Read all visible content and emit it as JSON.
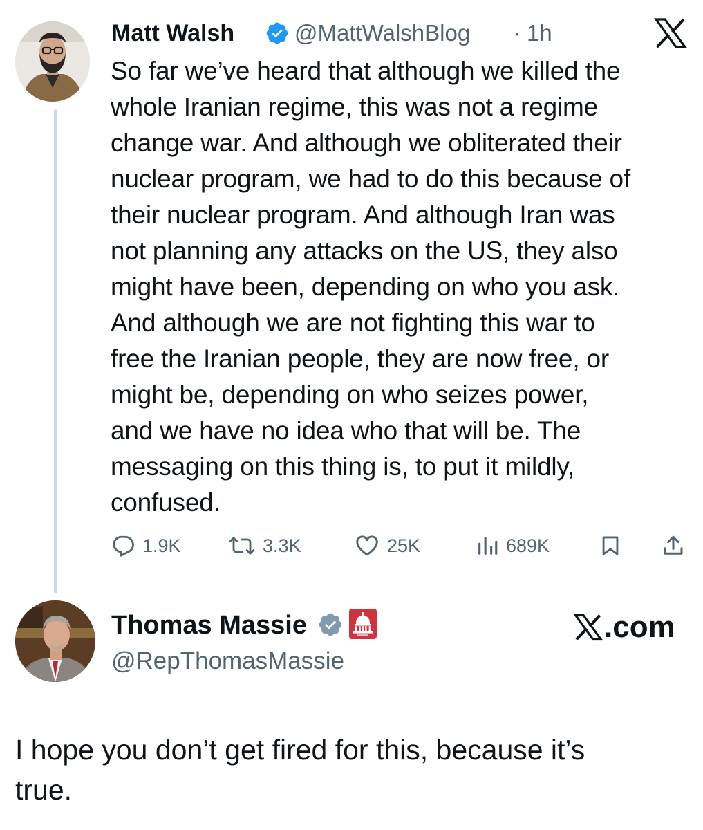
{
  "post": {
    "author_name": "Matt Walsh",
    "handle": "@MattWalshBlog",
    "separator": "·",
    "time": "1h",
    "text_lines": [
      "So far we’ve heard that although we killed the",
      "whole Iranian regime, this was not a regime",
      "change war. And although we obliterated their",
      "nuclear program, we had to do this because of",
      "their nuclear program. And although Iran was",
      "not planning any attacks on the US, they also",
      "might have been, depending on who you ask.",
      "And although we are not fighting this war to",
      "free the Iranian people, they are now free, or",
      "might be, depending on who seizes power,",
      "and we have no idea who that will be. The",
      "messaging on this thing is, to put it mildly,",
      "confused."
    ],
    "stats": {
      "replies": "1.9K",
      "reposts": "3.3K",
      "likes": "25K",
      "views": "689K"
    },
    "icons": {
      "verified": "verified-badge-icon",
      "platform": "x-logo-icon",
      "reply": "reply-icon",
      "repost": "repost-icon",
      "like": "heart-icon",
      "views": "views-chart-icon",
      "bookmark": "bookmark-icon",
      "share": "share-icon"
    }
  },
  "reply": {
    "author_name": "Thomas Massie",
    "handle": "@RepThomasMassie",
    "site": ".com",
    "text_lines": [
      "I hope you don’t get fired for this, because it’s",
      "true."
    ],
    "icons": {
      "verified": "gray-verified-badge-icon",
      "affiliation": "capitol-government-badge-icon",
      "platform": "x-logo-icon"
    }
  },
  "colors": {
    "verified_blue": "#1d9bf0",
    "gov_red": "#d0323e",
    "secondary_text": "#536471",
    "primary_text": "#0f1419",
    "thread_line": "#cfd9de"
  }
}
